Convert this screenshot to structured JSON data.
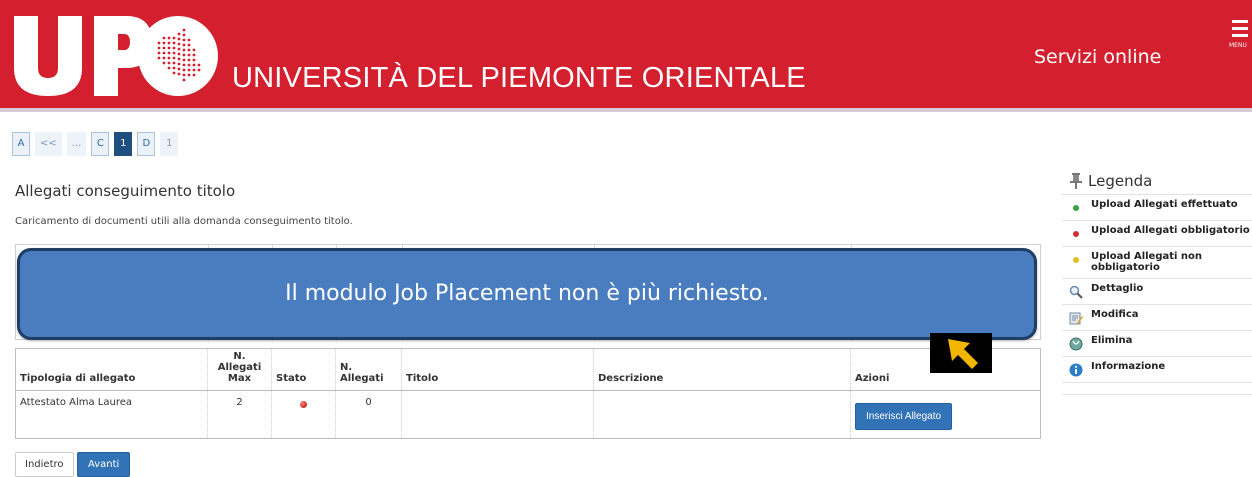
{
  "header": {
    "logo_text": "UPO",
    "university_name": "UNIVERSITÀ DEL PIEMONTE ORIENTALE",
    "services_label": "Servizi online",
    "menu_label": "MENU",
    "bg_color": "#d4202e"
  },
  "pager": {
    "steps": [
      "A",
      "<<",
      "...",
      "C",
      "1",
      "D",
      "1"
    ],
    "active_step": "1"
  },
  "page": {
    "title": "Allegati conseguimento titolo",
    "description": "Caricamento di documenti utili alla domanda conseguimento titolo."
  },
  "overlay_message": "Il modulo Job Placement non è più richiesto.",
  "table": {
    "headers": [
      "Tipologia di allegato",
      "N. Allegati Max",
      "Stato",
      "N. Allegati",
      "Titolo",
      "Descrizione",
      "Azioni"
    ],
    "rows": [
      {
        "type": "Attestato Alma Laurea",
        "max": "2",
        "status_icon": "red-dot-icon",
        "count": "0",
        "title": "",
        "description": "",
        "action_label": "Inserisci Allegato"
      }
    ]
  },
  "buttons": {
    "back": "Indietro",
    "next": "Avanti"
  },
  "legend": {
    "title": "Legenda",
    "items": [
      {
        "icon": "green-dot-icon",
        "label": "Upload Allegati effettuato"
      },
      {
        "icon": "red-dot-icon",
        "label": "Upload Allegati obbligatorio"
      },
      {
        "icon": "yellow-dot-icon",
        "label": "Upload Allegati non obbligatorio"
      },
      {
        "icon": "magnifier-icon",
        "label": "Dettaglio"
      },
      {
        "icon": "edit-icon",
        "label": "Modifica"
      },
      {
        "icon": "delete-icon",
        "label": "Elimina"
      },
      {
        "icon": "info-icon",
        "label": "Informazione"
      }
    ]
  },
  "colors": {
    "primary_blue": "#3272b6",
    "overlay_blue": "#4a7dbf",
    "status_red": "#d32f2f",
    "status_green": "#3aa43a",
    "status_yellow": "#e0c020"
  }
}
